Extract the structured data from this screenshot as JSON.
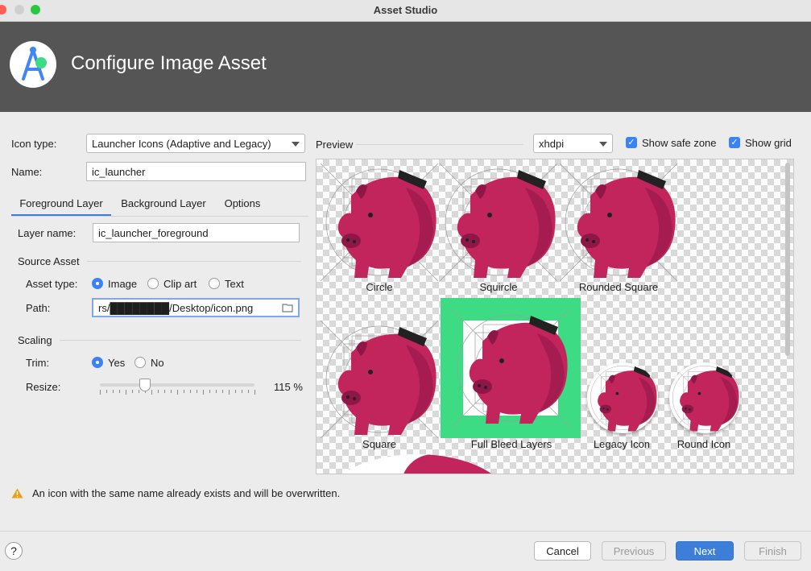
{
  "window": {
    "title": "Asset Studio"
  },
  "header": {
    "title": "Configure Image Asset"
  },
  "form": {
    "icon_type_label": "Icon type:",
    "icon_type_value": "Launcher Icons (Adaptive and Legacy)",
    "name_label": "Name:",
    "name_value": "ic_launcher",
    "tabs": [
      "Foreground Layer",
      "Background Layer",
      "Options"
    ],
    "layer_name_label": "Layer name:",
    "layer_name_value": "ic_launcher_foreground",
    "source_asset_title": "Source Asset",
    "asset_type_label": "Asset type:",
    "asset_types": [
      "Image",
      "Clip art",
      "Text"
    ],
    "selected_asset_type": "Image",
    "path_label": "Path:",
    "path_value": "rs/████████/Desktop/icon.png",
    "scaling_title": "Scaling",
    "trim_label": "Trim:",
    "trim_options": [
      "Yes",
      "No"
    ],
    "trim_selected": "Yes",
    "resize_label": "Resize:",
    "resize_value": "115 %",
    "resize_fraction": 0.15
  },
  "preview": {
    "label": "Preview",
    "density": "xhdpi",
    "show_safe_zone": "Show safe zone",
    "show_grid": "Show grid",
    "show_safe_zone_checked": true,
    "show_grid_checked": true,
    "captions": [
      "Circle",
      "Squircle",
      "Rounded Square",
      "Square",
      "Full Bleed Layers",
      "Legacy Icon",
      "Round Icon"
    ]
  },
  "warning": {
    "text": "An icon with the same name already exists and will be overwritten."
  },
  "buttons": {
    "help": "?",
    "cancel": "Cancel",
    "previous": "Previous",
    "next": "Next",
    "finish": "Finish"
  },
  "colors": {
    "header_bg": "#555555",
    "accent": "#3d7fd8",
    "pig": "#c2255c",
    "pig_dark": "#8e1747",
    "full_bleed": "#3ddc84"
  }
}
